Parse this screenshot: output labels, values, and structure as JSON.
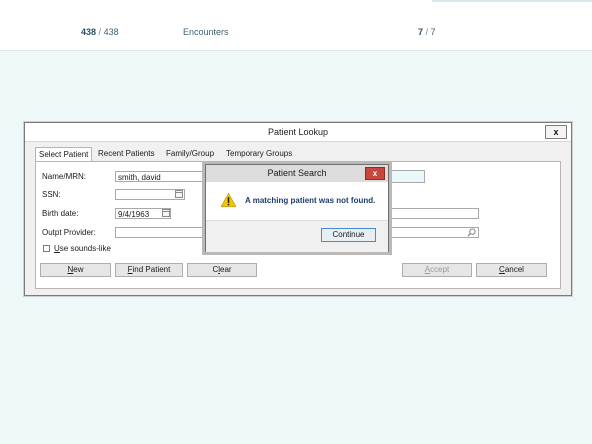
{
  "header": {
    "counter1": {
      "current": "438",
      "total": "438"
    },
    "encounters_label": "Encounters",
    "counter2": {
      "current": "7",
      "total": "7"
    }
  },
  "window": {
    "title": "Patient Lookup",
    "close_label": "x",
    "tabs": [
      {
        "label": "Select Patient",
        "active": true
      },
      {
        "label": "Recent Patients",
        "active": false
      },
      {
        "label": "Family/Group",
        "active": false
      },
      {
        "label": "Temporary Groups",
        "active": false
      }
    ],
    "form": {
      "name_label": "Name/MRN:",
      "name_value": "smith, david",
      "ssn_label": "SSN:",
      "ssn_value": "",
      "birth_label": "Birth date:",
      "birth_value": "9/4/1963",
      "provider_label": "Outpt Provider:",
      "provider_value": "",
      "sounds_like_label": "Use sounds-like",
      "sounds_like_checked": false
    },
    "buttons": {
      "new": "New",
      "find": "Find Patient",
      "clear": "Clear",
      "accept": "Accept",
      "cancel": "Cancel"
    }
  },
  "dialog": {
    "title": "Patient Search",
    "close_label": "x",
    "message": "A matching patient was not found.",
    "continue": "Continue",
    "icon": "warning-icon"
  },
  "colors": {
    "background": "#eef8f8",
    "dialog_close": "#c9463d",
    "message_text": "#1c3d6e",
    "warning": "#f5c400"
  }
}
